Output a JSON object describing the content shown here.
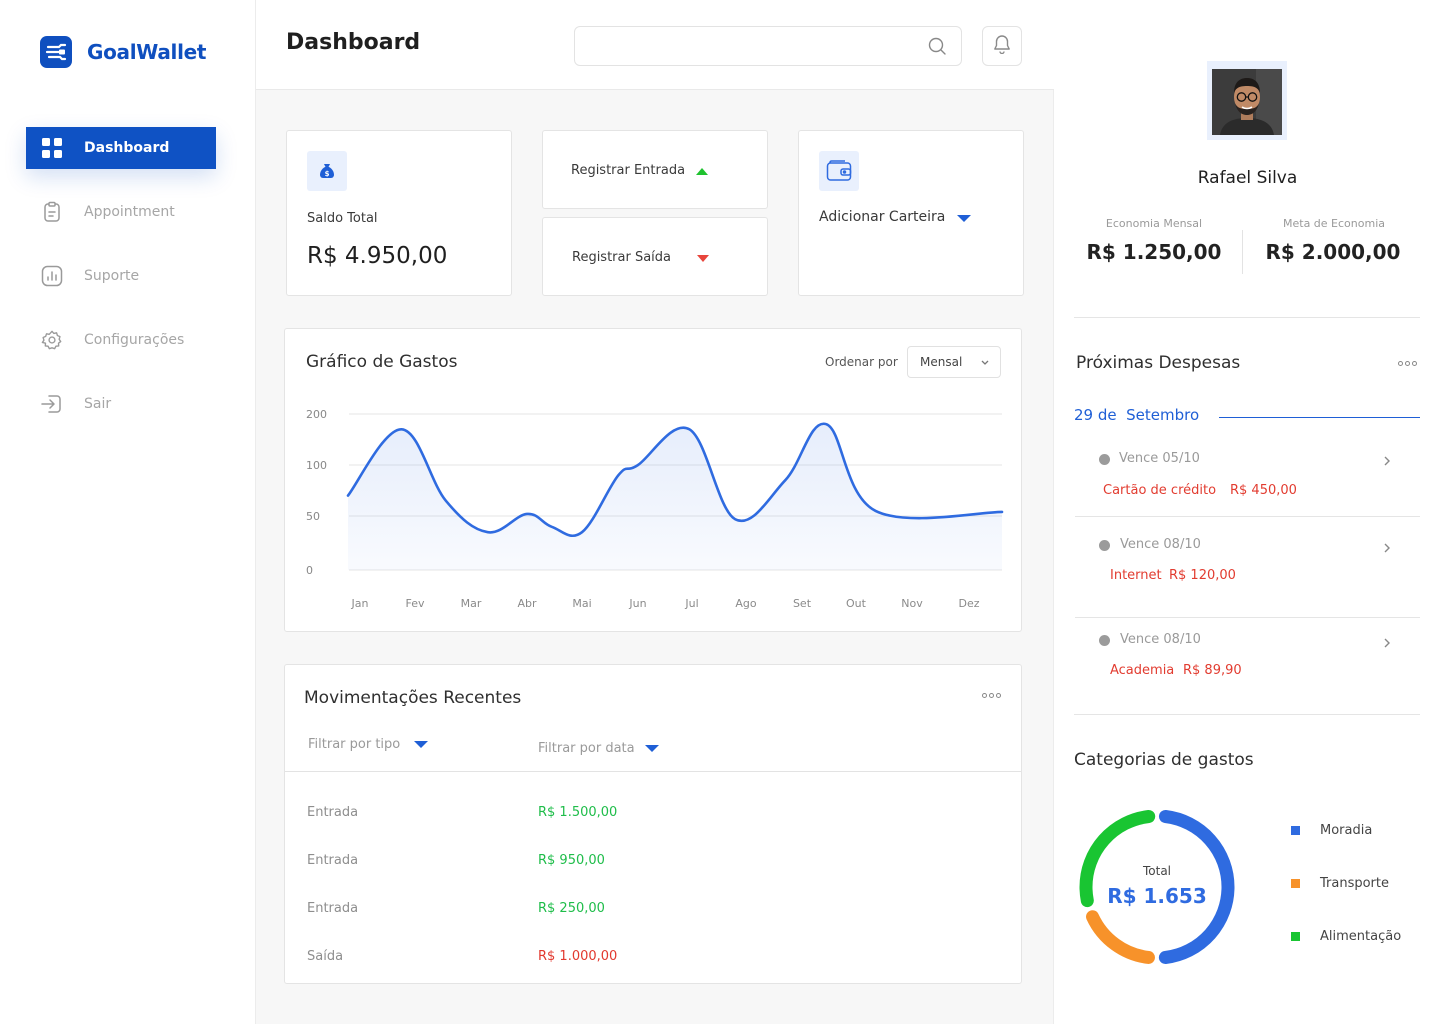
{
  "app": {
    "name": "GoalWallet"
  },
  "sidebar": {
    "items": [
      {
        "label": "Dashboard",
        "icon": "grid-icon",
        "active": true
      },
      {
        "label": "Appointment",
        "icon": "clipboard-icon"
      },
      {
        "label": "Suporte",
        "icon": "chart-bars-icon"
      },
      {
        "label": "Configurações",
        "icon": "gear-icon"
      },
      {
        "label": "Sair",
        "icon": "logout-icon"
      }
    ]
  },
  "header": {
    "title": "Dashboard",
    "search_value": ""
  },
  "cards": {
    "saldo": {
      "label": "Saldo Total",
      "value": "R$ 4.950,00"
    },
    "entrada": {
      "label": "Registrar Entrada"
    },
    "saida": {
      "label": "Registrar Saída"
    },
    "carteira": {
      "label": "Adicionar Carteira"
    }
  },
  "chart": {
    "title": "Gráfico de Gastos",
    "sort_label": "Ordenar por",
    "sort_value": "Mensal"
  },
  "chart_data": {
    "type": "area",
    "title": "Gráfico de Gastos",
    "categories": [
      "Jan",
      "Fev",
      "Mar",
      "Abr",
      "Mai",
      "Jun",
      "Jul",
      "Ago",
      "Set",
      "Out",
      "Nov",
      "Dez"
    ],
    "y_ticks": [
      "200",
      "100",
      "50",
      "0"
    ],
    "ylim": [
      0,
      200
    ],
    "grid": true,
    "series": [
      {
        "values": [
          [
            0,
            70
          ],
          [
            0.8,
            170
          ],
          [
            1.55,
            65
          ],
          [
            2.3,
            35
          ],
          [
            3.0,
            52
          ],
          [
            3.45,
            40
          ],
          [
            4.0,
            35
          ],
          [
            4.65,
            90
          ],
          [
            5.0,
            100
          ],
          [
            5.95,
            170
          ],
          [
            6.8,
            47
          ],
          [
            7.7,
            85
          ],
          [
            8.45,
            180
          ],
          [
            9.35,
            55
          ],
          [
            9.9,
            54
          ]
        ]
      }
    ],
    "color": "#2f6be0"
  },
  "movements": {
    "title": "Movimentações Recentes",
    "filter_type": "Filtrar por tipo",
    "filter_date": "Filtrar por data",
    "rows": [
      {
        "type": "Entrada",
        "amount": "R$ 1.500,00"
      },
      {
        "type": "Entrada",
        "amount": "R$ 950,00"
      },
      {
        "type": "Entrada",
        "amount": "R$ 250,00"
      },
      {
        "type": "Saída",
        "amount": "R$ 1.000,00"
      }
    ]
  },
  "profile": {
    "name": "Rafael Silva",
    "stats": [
      {
        "label": "Economia Mensal",
        "value": "R$ 1.250,00"
      },
      {
        "label": "Meta de Economia",
        "value": "R$ 2.000,00"
      }
    ]
  },
  "expenses": {
    "title": "Próximas Despesas",
    "date": "29 de  Setembro",
    "items": [
      {
        "due": "Vence 05/10",
        "name": "Cartão de crédito",
        "amount": "R$ 450,00"
      },
      {
        "due": "Vence 08/10",
        "name": "Internet",
        "amount": "R$ 120,00"
      },
      {
        "due": "Vence 08/10",
        "name": "Academia",
        "amount": "R$ 89,90"
      }
    ]
  },
  "categories": {
    "title": "Categorias de gastos",
    "total_label": "Total",
    "total_value": "R$ 1.653",
    "items": [
      {
        "label": "Moradia",
        "color": "#2f6be0",
        "fraction": 0.5
      },
      {
        "label": "Transporte",
        "color": "#f7922a",
        "fraction": 0.2
      },
      {
        "label": "Alimentação",
        "color": "#19c532",
        "fraction": 0.3
      }
    ]
  },
  "colors": {
    "accent": "#0f52c4",
    "positive": "#1fc22f",
    "negative": "#e8453c"
  }
}
